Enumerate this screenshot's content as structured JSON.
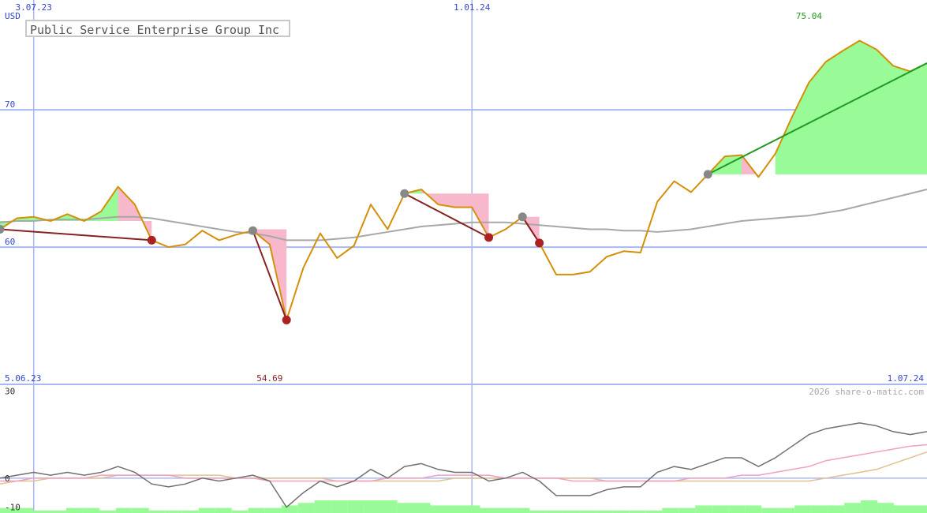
{
  "title": "Public Service Enterprise Group Inc",
  "currency": "USD",
  "copyright": "2026 share-o-matic.com",
  "colors": {
    "price_line": "#d4900a",
    "ma_line": "#a8a8a8",
    "gain_fill": "#98fb98",
    "loss_fill": "#f8b8cc",
    "grid": "#aab8f0",
    "axis_text": "#3344cc",
    "buy_marker": "#888888",
    "sell_marker": "#aa2222",
    "up_trend": "#229922",
    "down_trend": "#882222",
    "osc_dark": "#707070",
    "osc_pink": "#f0a0c0",
    "osc_tan": "#e0c090",
    "volume": "#98fb98"
  },
  "chart_data": {
    "type": "line",
    "x_start": "5.06.23",
    "x_end": "1.07.24",
    "x_ticks": [
      "3.07.23",
      "1.01.24"
    ],
    "x_tick_index": [
      2,
      28
    ],
    "ylim": [
      50,
      78
    ],
    "y_ticks": [
      60,
      70
    ],
    "y_label": "USD",
    "annotations": {
      "max_label": "75.04",
      "min_label": "54.69",
      "max_index": 48,
      "min_index": 16
    },
    "series": [
      {
        "role": "price",
        "values": [
          61.3,
          62.1,
          62.2,
          61.9,
          62.4,
          61.9,
          62.6,
          64.4,
          63.1,
          60.5,
          60.0,
          60.2,
          61.2,
          60.5,
          60.9,
          61.2,
          60.2,
          54.69,
          58.5,
          61.0,
          59.2,
          60.1,
          63.1,
          61.3,
          63.9,
          64.2,
          63.1,
          62.9,
          62.9,
          60.7,
          61.3,
          62.2,
          60.3,
          58.0,
          58.0,
          58.2,
          59.3,
          59.7,
          59.6,
          63.3,
          64.8,
          64.0,
          65.3,
          66.6,
          66.7,
          65.1,
          66.8,
          69.5,
          72.0,
          73.5,
          74.3,
          75.04,
          74.4,
          73.2,
          72.8,
          73.4
        ]
      },
      {
        "role": "moving-average",
        "values": [
          61.8,
          61.9,
          61.9,
          62.0,
          62.0,
          62.0,
          62.1,
          62.2,
          62.2,
          62.1,
          61.9,
          61.7,
          61.5,
          61.3,
          61.1,
          61.0,
          60.8,
          60.5,
          60.5,
          60.5,
          60.6,
          60.7,
          60.9,
          61.1,
          61.3,
          61.5,
          61.6,
          61.7,
          61.8,
          61.8,
          61.8,
          61.7,
          61.6,
          61.5,
          61.4,
          61.3,
          61.3,
          61.2,
          61.2,
          61.1,
          61.2,
          61.3,
          61.5,
          61.7,
          61.9,
          62.0,
          62.1,
          62.2,
          62.3,
          62.5,
          62.7,
          63.0,
          63.3,
          63.6,
          63.9,
          64.2
        ]
      }
    ],
    "gain_bands": [
      {
        "from": 0,
        "to": 8,
        "base": 61.9
      },
      {
        "from": 24,
        "to": 25,
        "base": 63.9
      },
      {
        "from": 42,
        "to": 44,
        "base": 65.3
      },
      {
        "from": 46,
        "to": 55,
        "base": 65.3
      }
    ],
    "loss_bands": [
      {
        "from": 7,
        "to": 9,
        "base": 61.9
      },
      {
        "from": 15,
        "to": 17,
        "base": 61.3
      },
      {
        "from": 25,
        "to": 29,
        "base": 63.9
      },
      {
        "from": 31,
        "to": 32,
        "base": 62.2
      },
      {
        "from": 44,
        "to": 45,
        "base": 65.3
      }
    ],
    "trades": [
      {
        "buy": 0,
        "sell": 9,
        "trend": "down"
      },
      {
        "buy": 15,
        "sell": 17,
        "trend": "down"
      },
      {
        "buy": 24,
        "sell": 29,
        "trend": "down"
      },
      {
        "buy": 31,
        "sell": 32,
        "trend": "down"
      },
      {
        "buy": 42,
        "sell": 55,
        "trend": "up"
      }
    ],
    "oscillator": {
      "ylim": [
        -12,
        32
      ],
      "y_ticks": [
        30,
        0,
        -10
      ],
      "series": [
        {
          "role": "momentum",
          "values": [
            0,
            1,
            2,
            1,
            2,
            1,
            2,
            4,
            2,
            -2,
            -3,
            -2,
            0,
            -1,
            0,
            1,
            -1,
            -10,
            -5,
            -1,
            -3,
            -1,
            3,
            0,
            4,
            5,
            3,
            2,
            2,
            -1,
            0,
            2,
            -1,
            -6,
            -6,
            -6,
            -4,
            -3,
            -3,
            2,
            4,
            3,
            5,
            7,
            7,
            4,
            7,
            11,
            15,
            17,
            18,
            19,
            18,
            16,
            15,
            16
          ]
        },
        {
          "role": "signal",
          "values": [
            -1,
            -1,
            0,
            0,
            0,
            0,
            1,
            1,
            1,
            1,
            1,
            0,
            0,
            0,
            0,
            0,
            -1,
            -1,
            -1,
            -1,
            -1,
            -1,
            -1,
            0,
            0,
            0,
            1,
            1,
            1,
            1,
            0,
            0,
            0,
            0,
            -1,
            -1,
            -1,
            -1,
            -1,
            -1,
            -1,
            0,
            0,
            0,
            1,
            1,
            2,
            3,
            4,
            6,
            7,
            8,
            9,
            10,
            11,
            11.5
          ]
        },
        {
          "role": "slow",
          "values": [
            -2,
            -1,
            -1,
            0,
            0,
            0,
            0,
            1,
            1,
            1,
            1,
            1,
            1,
            1,
            0,
            0,
            0,
            0,
            0,
            0,
            -1,
            -1,
            -1,
            -1,
            -1,
            -1,
            -1,
            0,
            0,
            0,
            0,
            0,
            0,
            0,
            0,
            0,
            -1,
            -1,
            -1,
            -1,
            -1,
            -1,
            -1,
            -1,
            -1,
            -1,
            -1,
            -1,
            -1,
            0,
            1,
            2,
            3,
            5,
            7,
            9
          ]
        }
      ],
      "volume": [
        2,
        2,
        1,
        1,
        2,
        2,
        1,
        2,
        2,
        1,
        1,
        1,
        2,
        2,
        1,
        2,
        2,
        3,
        4,
        5,
        5,
        5,
        5,
        5,
        4,
        4,
        3,
        3,
        3,
        2,
        2,
        2,
        1,
        1,
        1,
        1,
        1,
        1,
        1,
        1,
        2,
        2,
        3,
        3,
        3,
        3,
        2,
        2,
        3,
        3,
        3,
        4,
        5,
        4,
        3,
        3
      ]
    }
  }
}
